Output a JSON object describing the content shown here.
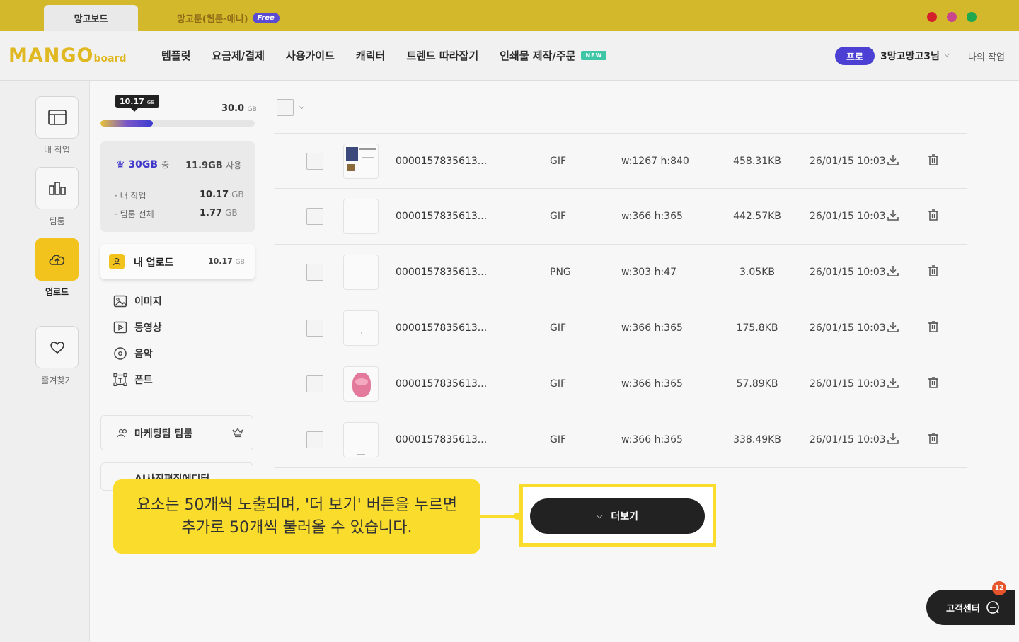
{
  "tabs": {
    "active": "망고보드",
    "second": "망고툰(웹툰·애니)",
    "second_badge": "Free"
  },
  "header": {
    "logo_main": "MANGO",
    "logo_sub": "board",
    "nav": [
      "템플릿",
      "요금제/결제",
      "사용가이드",
      "캐릭터",
      "트렌드 따라잡기",
      "인쇄물 제작/주문"
    ],
    "nav_new_badge": "NEW",
    "pro_badge": "프로",
    "user_name": "3망고망고3님",
    "my_work": "나의 작업"
  },
  "rail": {
    "items": [
      {
        "label": "내 작업",
        "icon": "layout-icon"
      },
      {
        "label": "팀룸",
        "icon": "team-icon"
      },
      {
        "label": "업로드",
        "icon": "cloud-upload-icon",
        "active": true
      },
      {
        "label": "즐겨찾기",
        "icon": "heart-icon"
      }
    ]
  },
  "storage": {
    "used": "10.17",
    "used_unit": "GB",
    "total": "30.0",
    "total_unit": "GB",
    "fill_fraction": 0.339,
    "plan": "30GB",
    "plan_suffix": "중",
    "plan_used": "11.9GB",
    "plan_used_suffix": "사용",
    "rows": [
      {
        "label": "· 내 작업",
        "value": "10.17",
        "unit": "GB"
      },
      {
        "label": "· 팀룸 전체",
        "value": "1.77",
        "unit": "GB"
      }
    ]
  },
  "upload": {
    "title": "내 업로드",
    "size": "10.17",
    "size_unit": "GB",
    "sub_items": [
      "이미지",
      "동영상",
      "음악",
      "폰트"
    ]
  },
  "teams": {
    "team1": "마케팅팀 팀룸",
    "team2": "AI사진편집에디터"
  },
  "table": {
    "rows": [
      {
        "name": "0000157835613...",
        "type": "GIF",
        "dim": "w:1267  h:840",
        "size": "458.31KB",
        "date": "26/01/15 10:03"
      },
      {
        "name": "0000157835613...",
        "type": "GIF",
        "dim": "w:366  h:365",
        "size": "442.57KB",
        "date": "26/01/15 10:03"
      },
      {
        "name": "0000157835613...",
        "type": "PNG",
        "dim": "w:303  h:47",
        "size": "3.05KB",
        "date": "26/01/15 10:03"
      },
      {
        "name": "0000157835613...",
        "type": "GIF",
        "dim": "w:366  h:365",
        "size": "175.8KB",
        "date": "26/01/15 10:03"
      },
      {
        "name": "0000157835613...",
        "type": "GIF",
        "dim": "w:366  h:365",
        "size": "57.89KB",
        "date": "26/01/15 10:03"
      },
      {
        "name": "0000157835613...",
        "type": "GIF",
        "dim": "w:366  h:365",
        "size": "338.49KB",
        "date": "26/01/15 10:03"
      }
    ]
  },
  "callout": {
    "line1": "요소는 50개씩 노출되며, '더 보기' 버튼을 누르면",
    "line2": "추가로 50개씩 불러올 수 있습니다."
  },
  "more_button": "더보기",
  "customer_center": {
    "label": "고객센터",
    "badge": "12"
  },
  "colors": {
    "brand_yellow": "#f2c31c",
    "callout_yellow": "#fadc2c",
    "pro_purple": "#4b3fd4"
  }
}
